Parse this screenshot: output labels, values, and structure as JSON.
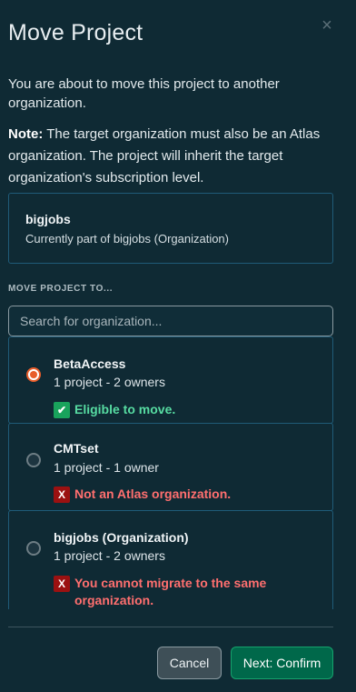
{
  "modal": {
    "title": "Move Project",
    "close_symbol": "×",
    "description": "You are about to move this project to another organization.",
    "note_label": "Note:",
    "note_text": " The target organization must also be an Atlas organization. The project will inherit the target organization's subscription level."
  },
  "current": {
    "name": "bigjobs",
    "subtitle": "Currently part of bigjobs (Organization)"
  },
  "move_to": {
    "label": "MOVE PROJECT TO...",
    "search_placeholder": "Search for organization..."
  },
  "organizations": [
    {
      "name": "BetaAccess",
      "meta": "1 project - 2 owners",
      "status_icon": "check-icon",
      "status_symbol": "✔",
      "status": "Eligible to move.",
      "selected": true
    },
    {
      "name": "CMTset",
      "meta": "1 project - 1 owner",
      "status_icon": "x-icon",
      "status_symbol": "X",
      "status": "Not an Atlas organization.",
      "selected": false
    },
    {
      "name": "bigjobs (Organization)",
      "meta": "1 project - 2 owners",
      "status_icon": "x-icon",
      "status_symbol": "X",
      "status": "You cannot migrate to the same organization.",
      "selected": false
    }
  ],
  "footer": {
    "cancel_label": "Cancel",
    "next_label": "Next: Confirm"
  },
  "colors": {
    "background": "#0f2a34",
    "accent_radio": "#e85d2a",
    "success": "#57dca2",
    "error": "#ff6f6f",
    "primary_button": "#00684a"
  }
}
